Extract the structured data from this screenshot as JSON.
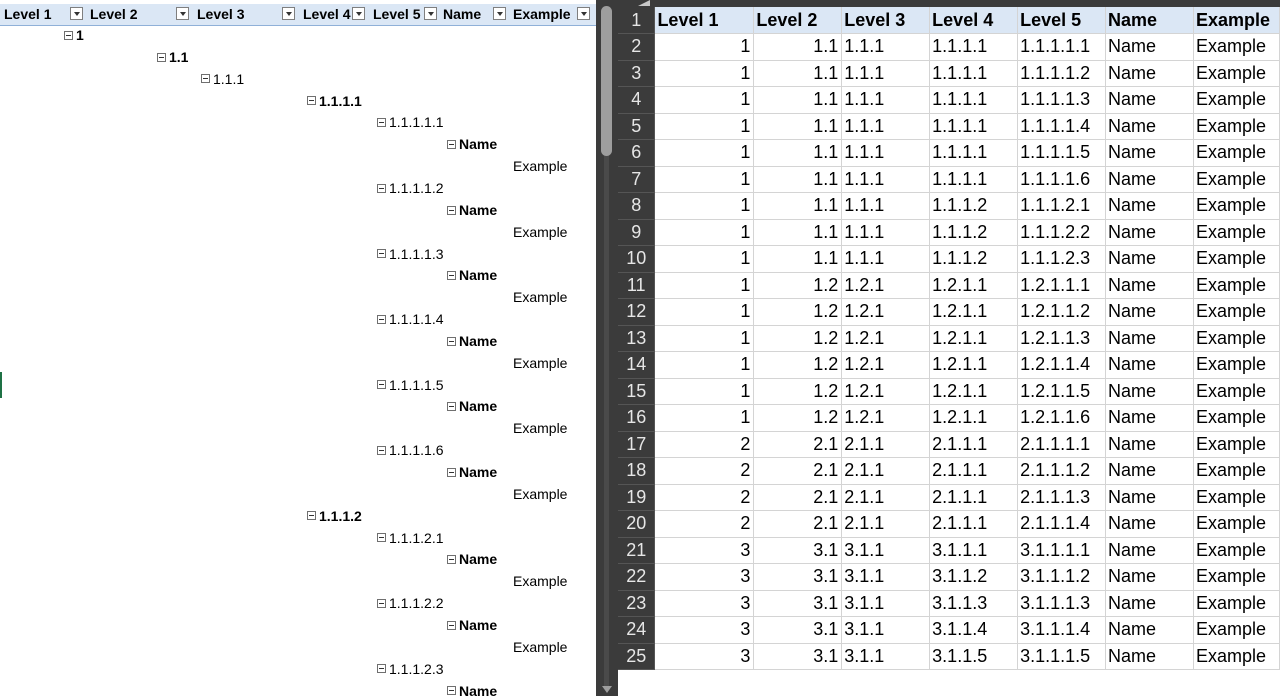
{
  "pivot": {
    "headers": [
      "Level 1",
      "Level 2",
      "Level 3",
      "Level 4",
      "Level 5",
      "Name",
      "Example"
    ],
    "rows": [
      {
        "text": "1",
        "minus": true,
        "bold": true,
        "level": 1
      },
      {
        "text": "1.1",
        "minus": true,
        "bold": true,
        "level": 2
      },
      {
        "text": "1.1.1",
        "minus": true,
        "bold": false,
        "level": 3
      },
      {
        "text": "1.1.1.1",
        "minus": true,
        "bold": true,
        "level": 4
      },
      {
        "text": "1.1.1.1.1",
        "minus": true,
        "bold": false,
        "level": 5
      },
      {
        "text": "Name",
        "minus": true,
        "bold": true,
        "level": 6
      },
      {
        "text": "Example",
        "minus": false,
        "bold": false,
        "level": 7
      },
      {
        "text": "1.1.1.1.2",
        "minus": true,
        "bold": false,
        "level": 5
      },
      {
        "text": "Name",
        "minus": true,
        "bold": true,
        "level": 6
      },
      {
        "text": "Example",
        "minus": false,
        "bold": false,
        "level": 7
      },
      {
        "text": "1.1.1.1.3",
        "minus": true,
        "bold": false,
        "level": 5
      },
      {
        "text": "Name",
        "minus": true,
        "bold": true,
        "level": 6
      },
      {
        "text": "Example",
        "minus": false,
        "bold": false,
        "level": 7
      },
      {
        "text": "1.1.1.1.4",
        "minus": true,
        "bold": false,
        "level": 5
      },
      {
        "text": "Name",
        "minus": true,
        "bold": true,
        "level": 6
      },
      {
        "text": "Example",
        "minus": false,
        "bold": false,
        "level": 7
      },
      {
        "text": "1.1.1.1.5",
        "minus": true,
        "bold": false,
        "level": 5
      },
      {
        "text": "Name",
        "minus": true,
        "bold": true,
        "level": 6
      },
      {
        "text": "Example",
        "minus": false,
        "bold": false,
        "level": 7
      },
      {
        "text": "1.1.1.1.6",
        "minus": true,
        "bold": false,
        "level": 5
      },
      {
        "text": "Name",
        "minus": true,
        "bold": true,
        "level": 6
      },
      {
        "text": "Example",
        "minus": false,
        "bold": false,
        "level": 7
      },
      {
        "text": "1.1.1.2",
        "minus": true,
        "bold": true,
        "level": 4
      },
      {
        "text": "1.1.1.2.1",
        "minus": true,
        "bold": false,
        "level": 5
      },
      {
        "text": "Name",
        "minus": true,
        "bold": true,
        "level": 6
      },
      {
        "text": "Example",
        "minus": false,
        "bold": false,
        "level": 7
      },
      {
        "text": "1.1.1.2.2",
        "minus": true,
        "bold": false,
        "level": 5
      },
      {
        "text": "Name",
        "minus": true,
        "bold": true,
        "level": 6
      },
      {
        "text": "Example",
        "minus": false,
        "bold": false,
        "level": 7
      },
      {
        "text": "1.1.1.2.3",
        "minus": true,
        "bold": false,
        "level": 5
      },
      {
        "text": "Name",
        "minus": true,
        "bold": true,
        "level": 6
      }
    ]
  },
  "sheet": {
    "header": [
      "Level 1",
      "Level 2",
      "Level 3",
      "Level 4",
      "Level 5",
      "Name",
      "Example"
    ],
    "row_numbers": [
      "1",
      "2",
      "3",
      "4",
      "5",
      "6",
      "7",
      "8",
      "9",
      "10",
      "11",
      "12",
      "13",
      "14",
      "15",
      "16",
      "17",
      "18",
      "19",
      "20",
      "21",
      "22",
      "23",
      "24",
      "25"
    ],
    "rows": [
      [
        "1",
        "1.1",
        "1.1.1",
        "1.1.1.1",
        "1.1.1.1.1",
        "Name",
        "Example"
      ],
      [
        "1",
        "1.1",
        "1.1.1",
        "1.1.1.1",
        "1.1.1.1.2",
        "Name",
        "Example"
      ],
      [
        "1",
        "1.1",
        "1.1.1",
        "1.1.1.1",
        "1.1.1.1.3",
        "Name",
        "Example"
      ],
      [
        "1",
        "1.1",
        "1.1.1",
        "1.1.1.1",
        "1.1.1.1.4",
        "Name",
        "Example"
      ],
      [
        "1",
        "1.1",
        "1.1.1",
        "1.1.1.1",
        "1.1.1.1.5",
        "Name",
        "Example"
      ],
      [
        "1",
        "1.1",
        "1.1.1",
        "1.1.1.1",
        "1.1.1.1.6",
        "Name",
        "Example"
      ],
      [
        "1",
        "1.1",
        "1.1.1",
        "1.1.1.2",
        "1.1.1.2.1",
        "Name",
        "Example"
      ],
      [
        "1",
        "1.1",
        "1.1.1",
        "1.1.1.2",
        "1.1.1.2.2",
        "Name",
        "Example"
      ],
      [
        "1",
        "1.1",
        "1.1.1",
        "1.1.1.2",
        "1.1.1.2.3",
        "Name",
        "Example"
      ],
      [
        "1",
        "1.2",
        "1.2.1",
        "1.2.1.1",
        "1.2.1.1.1",
        "Name",
        "Example"
      ],
      [
        "1",
        "1.2",
        "1.2.1",
        "1.2.1.1",
        "1.2.1.1.2",
        "Name",
        "Example"
      ],
      [
        "1",
        "1.2",
        "1.2.1",
        "1.2.1.1",
        "1.2.1.1.3",
        "Name",
        "Example"
      ],
      [
        "1",
        "1.2",
        "1.2.1",
        "1.2.1.1",
        "1.2.1.1.4",
        "Name",
        "Example"
      ],
      [
        "1",
        "1.2",
        "1.2.1",
        "1.2.1.1",
        "1.2.1.1.5",
        "Name",
        "Example"
      ],
      [
        "1",
        "1.2",
        "1.2.1",
        "1.2.1.1",
        "1.2.1.1.6",
        "Name",
        "Example"
      ],
      [
        "2",
        "2.1",
        "2.1.1",
        "2.1.1.1",
        "2.1.1.1.1",
        "Name",
        "Example"
      ],
      [
        "2",
        "2.1",
        "2.1.1",
        "2.1.1.1",
        "2.1.1.1.2",
        "Name",
        "Example"
      ],
      [
        "2",
        "2.1",
        "2.1.1",
        "2.1.1.1",
        "2.1.1.1.3",
        "Name",
        "Example"
      ],
      [
        "2",
        "2.1",
        "2.1.1",
        "2.1.1.1",
        "2.1.1.1.4",
        "Name",
        "Example"
      ],
      [
        "3",
        "3.1",
        "3.1.1",
        "3.1.1.1",
        "3.1.1.1.1",
        "Name",
        "Example"
      ],
      [
        "3",
        "3.1",
        "3.1.1",
        "3.1.1.2",
        "3.1.1.1.2",
        "Name",
        "Example"
      ],
      [
        "3",
        "3.1",
        "3.1.1",
        "3.1.1.3",
        "3.1.1.1.3",
        "Name",
        "Example"
      ],
      [
        "3",
        "3.1",
        "3.1.1",
        "3.1.1.4",
        "3.1.1.1.4",
        "Name",
        "Example"
      ],
      [
        "3",
        "3.1",
        "3.1.1",
        "3.1.1.5",
        "3.1.1.1.5",
        "Name",
        "Example"
      ]
    ]
  },
  "colors": {
    "header_bg": "#dbe7f5",
    "dark_chrome": "#3b3b3b",
    "selection_green": "#1e7145"
  }
}
